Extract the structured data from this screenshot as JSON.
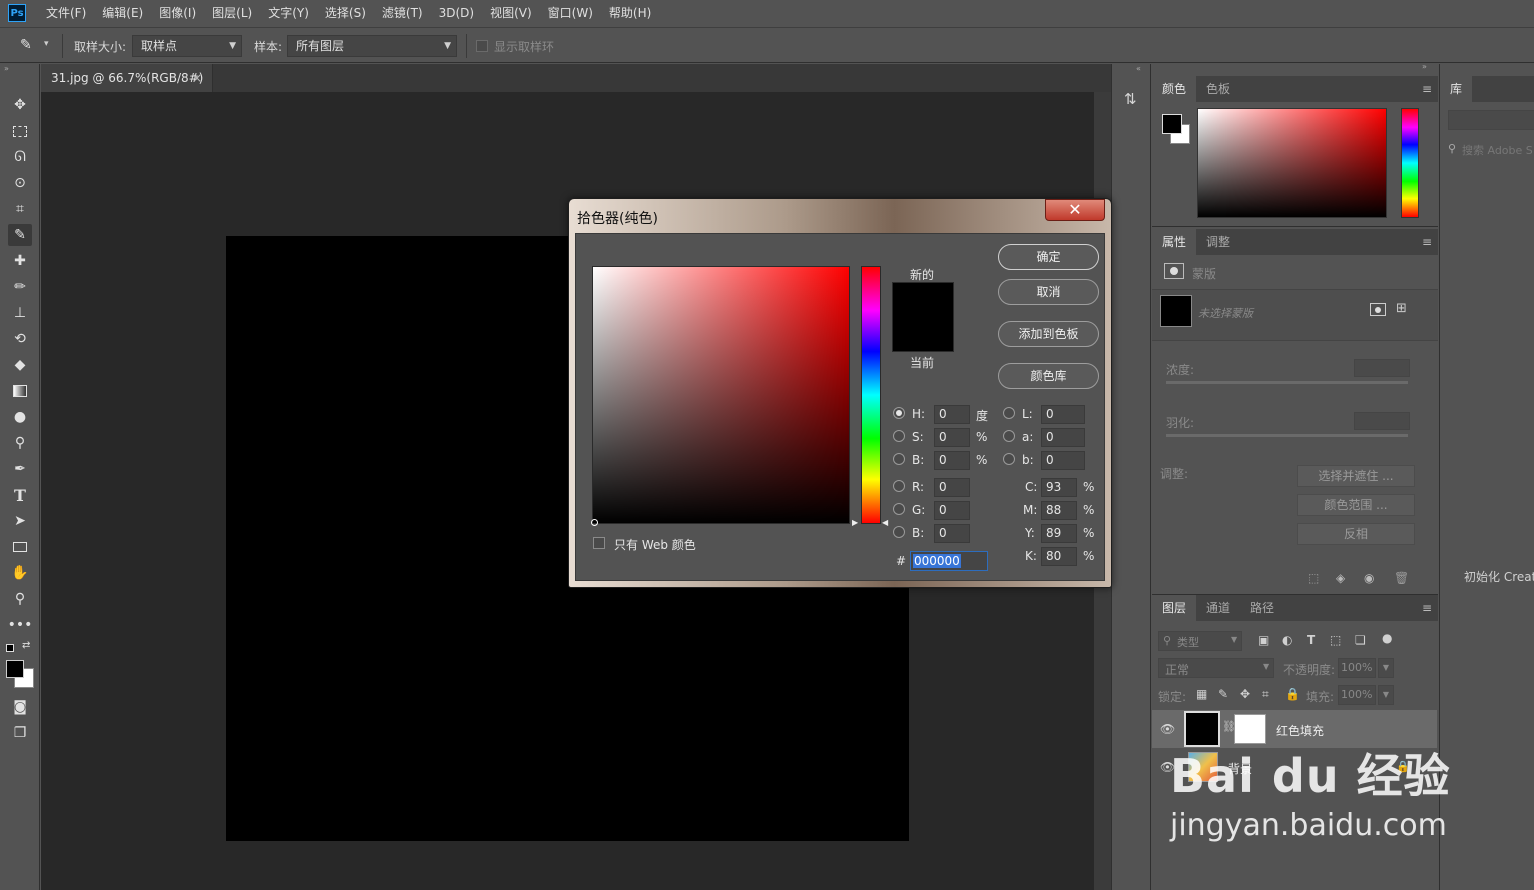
{
  "app": {
    "logo": "Ps"
  },
  "menu": [
    "文件(F)",
    "编辑(E)",
    "图像(I)",
    "图层(L)",
    "文字(Y)",
    "选择(S)",
    "滤镜(T)",
    "3D(D)",
    "视图(V)",
    "窗口(W)",
    "帮助(H)"
  ],
  "options": {
    "sample_size_label": "取样大小:",
    "sample_size_value": "取样点",
    "sample_label": "样本:",
    "sample_value": "所有图层",
    "show_ring_label": "显示取样环"
  },
  "document": {
    "tab_title": "31.jpg @ 66.7%(RGB/8#)",
    "close": "×"
  },
  "color_panel": {
    "tabs": [
      "颜色",
      "色板"
    ]
  },
  "properties_panel": {
    "tabs": [
      "属性",
      "调整"
    ],
    "section": "蒙版",
    "mask_name": "未选择蒙版",
    "density_label": "浓度:",
    "feather_label": "羽化:",
    "adjust_label": "调整:",
    "buttons": [
      "选择并遮住 ...",
      "颜色范围 ...",
      "反相"
    ]
  },
  "library_panel": {
    "tab": "库",
    "search_placeholder": "搜索 Adobe S",
    "status": "初始化 Creati"
  },
  "layers_panel": {
    "tabs": [
      "图层",
      "通道",
      "路径"
    ],
    "filter_label": "类型",
    "blend_mode": "正常",
    "opacity_label": "不透明度:",
    "opacity_value": "100%",
    "lock_label": "锁定:",
    "fill_label": "填充:",
    "fill_value": "100%",
    "layers": [
      {
        "name": "红色填充"
      },
      {
        "name": "背景"
      }
    ]
  },
  "color_picker": {
    "title": "拾色器(纯色)",
    "close": "✕",
    "new_label": "新的",
    "current_label": "当前",
    "buttons": {
      "ok": "确定",
      "cancel": "取消",
      "add_swatch": "添加到色板",
      "libraries": "颜色库"
    },
    "web_only_label": "只有 Web 颜色",
    "fields": {
      "H": {
        "label": "H:",
        "value": "0",
        "unit": "度"
      },
      "S": {
        "label": "S:",
        "value": "0",
        "unit": "%"
      },
      "Bv": {
        "label": "B:",
        "value": "0",
        "unit": "%"
      },
      "R": {
        "label": "R:",
        "value": "0"
      },
      "G": {
        "label": "G:",
        "value": "0"
      },
      "B": {
        "label": "B:",
        "value": "0"
      },
      "L": {
        "label": "L:",
        "value": "0"
      },
      "a": {
        "label": "a:",
        "value": "0"
      },
      "b": {
        "label": "b:",
        "value": "0"
      },
      "C": {
        "label": "C:",
        "value": "93",
        "unit": "%"
      },
      "M": {
        "label": "M:",
        "value": "88",
        "unit": "%"
      },
      "Y": {
        "label": "Y:",
        "value": "89",
        "unit": "%"
      },
      "K": {
        "label": "K:",
        "value": "80",
        "unit": "%"
      }
    },
    "hex_label": "#",
    "hex_value": "000000"
  },
  "watermark": {
    "brand": "Bai du 经验",
    "url": "jingyan.baidu.com"
  },
  "colors": {
    "accent": "#2fa3f7",
    "canvas": "#000000",
    "close_red": "#c0392b"
  }
}
